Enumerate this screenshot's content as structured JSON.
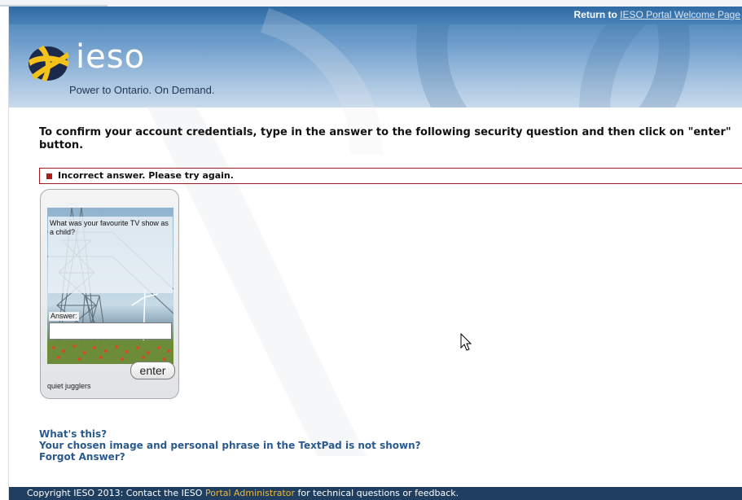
{
  "header": {
    "return_prefix": "Return to",
    "return_link": "IESO Portal Welcome Page",
    "logo_text": "ieso",
    "tagline": "Power to Ontario. On Demand."
  },
  "instructions": "To confirm your account credentials, type in the answer to the following security question and then click on \"enter\" button.",
  "error": {
    "message": "Incorrect answer. Please try again.",
    "color": "#a31b1b"
  },
  "security_pad": {
    "question": "What was your favourite TV show as a child?",
    "answer_label": "Answer:",
    "answer_value": "",
    "enter_label": "enter",
    "phrase": "quiet jugglers"
  },
  "help_links": [
    "What's this?",
    "Your chosen image and personal phrase in the TextPad is not shown?",
    "Forgot Answer?"
  ],
  "footer": {
    "prefix": "Copyright IESO 2013: Contact the IESO",
    "link": "Portal Administrator",
    "suffix": "for technical questions or feedback."
  },
  "colors": {
    "header_blue": "#3f7fb4",
    "link_blue": "#2b5a8e",
    "footer_bg": "#1f3e60",
    "footer_link": "#f0b83c",
    "logo_yellow": "#f4c21b"
  }
}
